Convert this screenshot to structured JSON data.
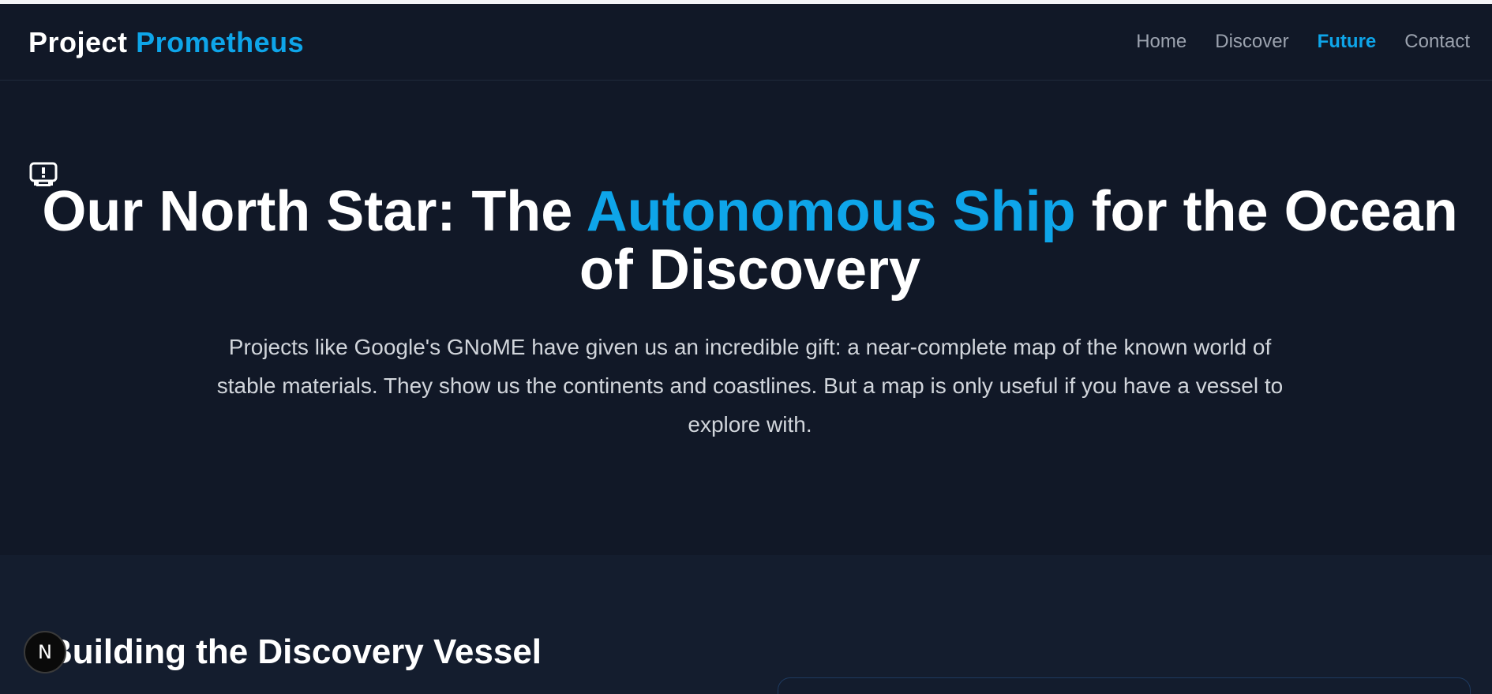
{
  "header": {
    "brand_first": "Project",
    "brand_second": "Prometheus",
    "nav": [
      {
        "label": "Home",
        "active": false
      },
      {
        "label": "Discover",
        "active": false
      },
      {
        "label": "Future",
        "active": true
      },
      {
        "label": "Contact",
        "active": false
      }
    ]
  },
  "hero": {
    "icon": "robot-icon",
    "title_pre": "Our North Star: The ",
    "title_accent": "Autonomous Ship",
    "title_post": " for the Ocean of Discovery",
    "subtitle": "Projects like Google's GNoME have given us an incredible gift: a near-complete map of the known world of stable materials. They show us the continents and coastlines. But a map is only useful if you have a vessel to explore with."
  },
  "section": {
    "title": "Building the Discovery Vessel"
  },
  "dev_badge": {
    "label": "N"
  },
  "colors": {
    "background": "#111827",
    "accent": "#0ea5e9",
    "text": "#ffffff",
    "muted": "#9ca3af"
  }
}
